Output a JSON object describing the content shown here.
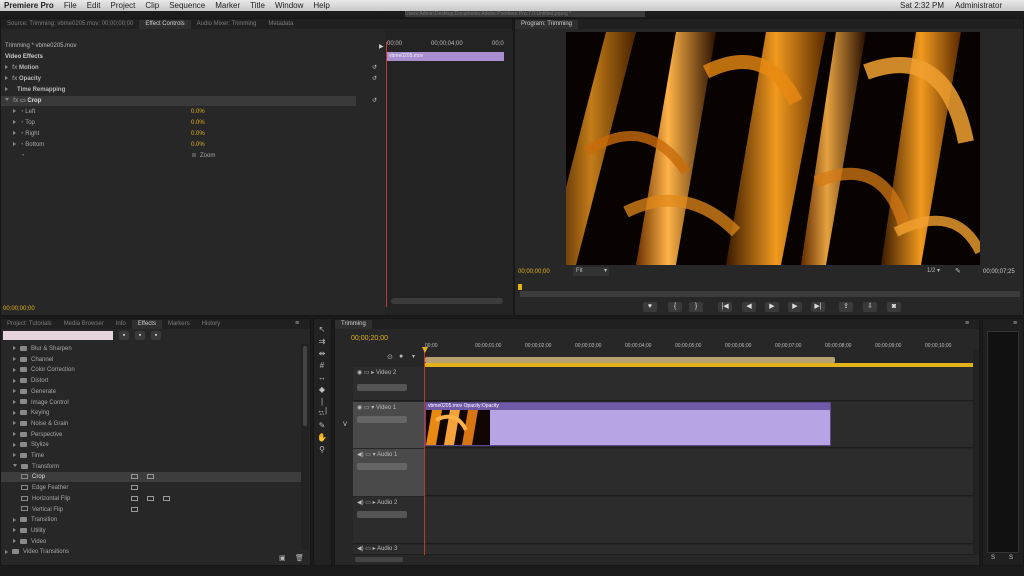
{
  "menubar": {
    "apple": "",
    "app": "Premiere Pro",
    "items": [
      "File",
      "Edit",
      "Project",
      "Clip",
      "Sequence",
      "Marker",
      "Title",
      "Window",
      "Help"
    ],
    "path": "Users:Admin:Desktop:Documents:Adobe:Premiere Pro:7.0:Untitled.prproj *",
    "clock": "Sat 2:32 PM",
    "user": "Administrator"
  },
  "source_panel": {
    "tabs": [
      "Source: Trimming: vbme0205.mov: 00;00;00;00",
      "Effect Controls",
      "Audio Mixer: Trimming",
      "Metadata"
    ],
    "active_tab": 1,
    "header": "Trimming * vbme0205.mov",
    "timecode_start": "00;00",
    "timecode_mid": "00;00;04;00",
    "timecode_end": "00;0",
    "clip_label": "vbme0205.mov",
    "video_effects": "Video Effects",
    "motion": "Motion",
    "opacity": "Opacity",
    "time_remapping": "Time Remapping",
    "crop": "Crop",
    "params": [
      {
        "name": "Left",
        "value": "0.0%"
      },
      {
        "name": "Top",
        "value": "0.0%"
      },
      {
        "name": "Right",
        "value": "0.0%"
      },
      {
        "name": "Bottom",
        "value": "0.0%"
      }
    ],
    "zoom": "Zoom",
    "timecode_footer": "00;00;00;00"
  },
  "program_monitor": {
    "tab": "Program: Trimming",
    "timecode": "00;00;00;00",
    "fit": "Fit",
    "resolution": "1/2",
    "duration": "00;00;07;25"
  },
  "project_panel": {
    "tabs": [
      "Project: Tutorials",
      "Media Browser",
      "Info",
      "Effects",
      "Markers",
      "History"
    ],
    "active_tab": 3,
    "search_placeholder": "",
    "items": [
      {
        "label": "Blur & Sharpen",
        "indent": 1,
        "type": "folder",
        "open": false
      },
      {
        "label": "Channel",
        "indent": 1,
        "type": "folder",
        "open": false
      },
      {
        "label": "Color Correction",
        "indent": 1,
        "type": "folder",
        "open": false
      },
      {
        "label": "Distort",
        "indent": 1,
        "type": "folder",
        "open": false
      },
      {
        "label": "Generate",
        "indent": 1,
        "type": "folder",
        "open": false
      },
      {
        "label": "Image Control",
        "indent": 1,
        "type": "folder",
        "open": false
      },
      {
        "label": "Keying",
        "indent": 1,
        "type": "folder",
        "open": false
      },
      {
        "label": "Noise & Grain",
        "indent": 1,
        "type": "folder",
        "open": false
      },
      {
        "label": "Perspective",
        "indent": 1,
        "type": "folder",
        "open": false
      },
      {
        "label": "Stylize",
        "indent": 1,
        "type": "folder",
        "open": false
      },
      {
        "label": "Time",
        "indent": 1,
        "type": "folder",
        "open": false
      },
      {
        "label": "Transform",
        "indent": 1,
        "type": "folder",
        "open": true
      },
      {
        "label": "Crop",
        "indent": 2,
        "type": "effect",
        "selected": true
      },
      {
        "label": "Edge Feather",
        "indent": 2,
        "type": "effect"
      },
      {
        "label": "Horizontal Flip",
        "indent": 2,
        "type": "effect"
      },
      {
        "label": "Vertical Flip",
        "indent": 2,
        "type": "effect"
      },
      {
        "label": "Transition",
        "indent": 1,
        "type": "folder",
        "open": false
      },
      {
        "label": "Utility",
        "indent": 1,
        "type": "folder",
        "open": false
      },
      {
        "label": "Video",
        "indent": 1,
        "type": "folder",
        "open": false
      },
      {
        "label": "Video Transitions",
        "indent": 0,
        "type": "folder",
        "open": false
      }
    ]
  },
  "timeline": {
    "tab": "Trimming",
    "timecode": "00;00;20;00",
    "ruler": [
      "00;00",
      "00;00;01;00",
      "00;00;02;00",
      "00;00;03;00",
      "00;00;04;00",
      "00;00;05;00",
      "00;00;06;00",
      "00;00;07;00",
      "00;00;08;00",
      "00;00;09;00",
      "00;00;10;00"
    ],
    "video2": "Video 2",
    "video1": "Video 1",
    "audio1": "Audio 1",
    "audio2": "Audio 2",
    "audio3": "Audio 3",
    "clip_label": "vbme0205.mov",
    "clip_opacity": "Opacity:Opacity",
    "v_label": "V"
  },
  "meter": {
    "s1": "S",
    "s2": "S"
  }
}
